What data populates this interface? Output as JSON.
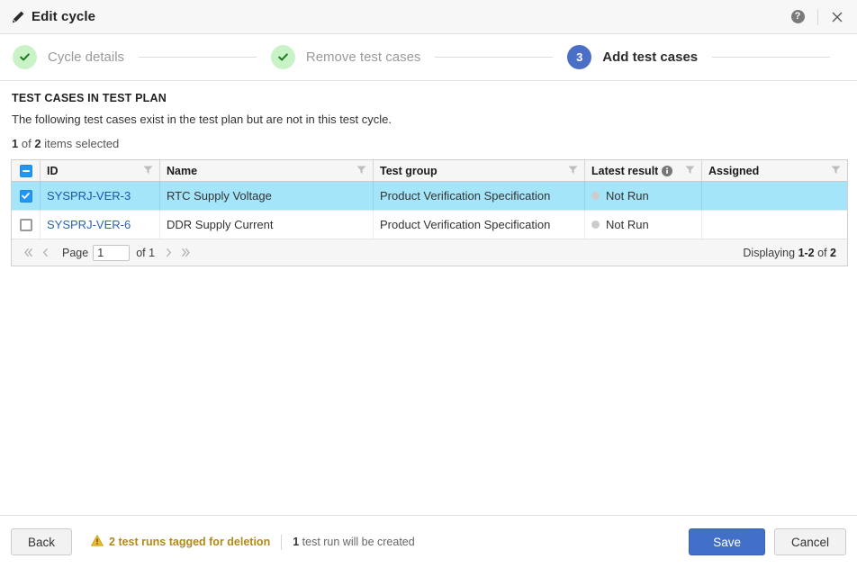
{
  "window": {
    "title": "Edit cycle",
    "edit_icon": "pencil-icon",
    "help_glyph": "?",
    "help_label": "Help",
    "close_label": "Close"
  },
  "stepper": {
    "steps": [
      {
        "marker": "✓",
        "label": "Cycle details",
        "state": "done"
      },
      {
        "marker": "✓",
        "label": "Remove test cases",
        "state": "done"
      },
      {
        "marker": "3",
        "label": "Add test cases",
        "state": "active"
      }
    ]
  },
  "main": {
    "section_title": "TEST CASES IN TEST PLAN",
    "section_desc": "The following test cases exist in the test plan but are not in this test cycle.",
    "selection": {
      "count": "1",
      "mid": "of",
      "total": "2",
      "suffix": "items selected"
    }
  },
  "table": {
    "header_checkbox_state": "indeterminate",
    "columns": [
      {
        "key": "id",
        "label": "ID",
        "filter": true
      },
      {
        "key": "name",
        "label": "Name",
        "filter": true
      },
      {
        "key": "group",
        "label": "Test group",
        "filter": true
      },
      {
        "key": "result",
        "label": "Latest result",
        "filter": true,
        "info": true
      },
      {
        "key": "assigned",
        "label": "Assigned",
        "filter": true
      }
    ],
    "rows": [
      {
        "selected": true,
        "checked": true,
        "id": "SYSPRJ-VER-3",
        "name": "RTC Supply Voltage",
        "group": "Product Verification Specification",
        "result": "Not Run",
        "result_color": "#cccccc",
        "assigned": ""
      },
      {
        "selected": false,
        "checked": false,
        "id": "SYSPRJ-VER-6",
        "name": "DDR Supply Current",
        "group": "Product Verification Specification",
        "result": "Not Run",
        "result_color": "#cccccc",
        "assigned": ""
      }
    ]
  },
  "pager": {
    "first_label": "First page",
    "prev_label": "Previous page",
    "page_label": "Page",
    "page_value": "1",
    "of_label": "of 1",
    "next_label": "Next page",
    "last_label": "Last page",
    "displaying_prefix": "Displaying",
    "displaying_range": "1-2",
    "displaying_mid": "of",
    "displaying_total": "2"
  },
  "footer": {
    "back_label": "Back",
    "warning_icon": "warning-triangle-icon",
    "warning_count": "2",
    "warning_text": "2 test runs tagged for deletion",
    "note_count": "1",
    "note_text": "1 test run will be created",
    "save_label": "Save",
    "cancel_label": "Cancel"
  },
  "colors": {
    "accent_blue": "#4270c9",
    "selection_blue": "#a5e5fa",
    "step_done_green": "#c9f3c6",
    "warning_gold": "#b08a14",
    "link_blue": "#2a63b5"
  }
}
